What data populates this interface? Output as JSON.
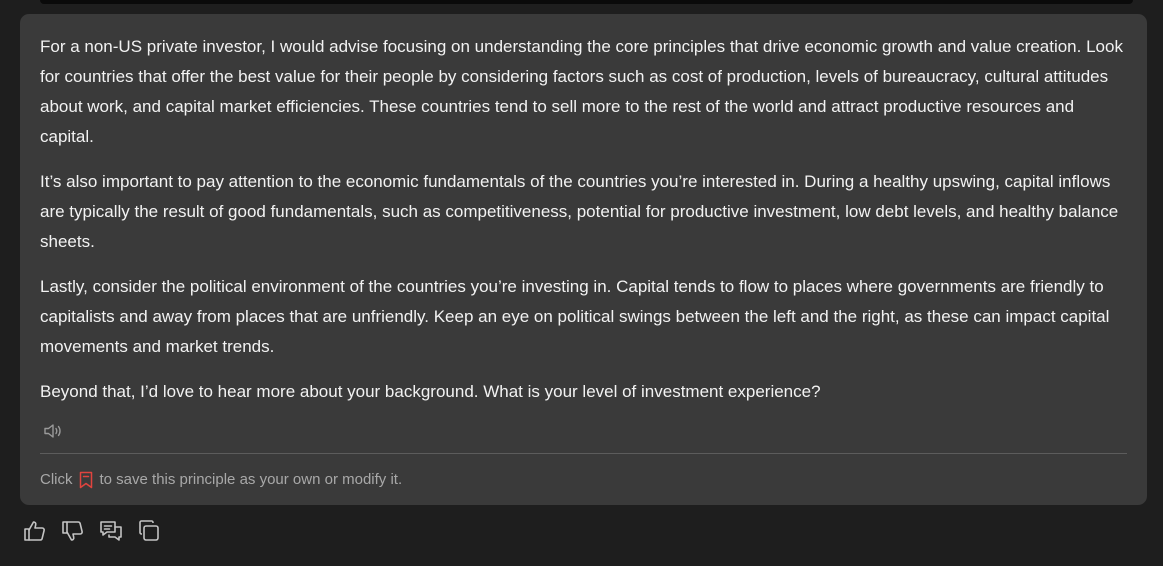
{
  "message": {
    "paragraphs": [
      "For a non-US private investor, I would advise focusing on understanding the core principles that drive economic growth and value creation. Look for countries that offer the best value for their people by considering factors such as cost of production, levels of bureaucracy, cultural attitudes about work, and capital market efficiencies. These countries tend to sell more to the rest of the world and attract productive resources and capital.",
      "It’s also important to pay attention to the economic fundamentals of the countries you’re interested in. During a healthy upswing, capital inflows are typically the result of good fundamentals, such as competitiveness, potential for productive investment, low debt levels, and healthy balance sheets.",
      "Lastly, consider the political environment of the countries you’re investing in. Capital tends to flow to places where governments are friendly to capitalists and away from places that are unfriendly. Keep an eye on political swings between the left and the right, as these can impact capital movements and market trends.",
      "Beyond that, I’d love to hear more about your background. What is your level of investment experience?"
    ]
  },
  "save_hint": {
    "prefix": "Click",
    "suffix": "to save this principle as your own or modify it."
  },
  "icons": {
    "speaker": "speaker-icon",
    "bookmark": "bookmark-icon",
    "thumbs_up": "thumbs-up-icon",
    "thumbs_down": "thumbs-down-icon",
    "feedback": "comment-icon",
    "copy": "copy-icon"
  },
  "colors": {
    "background": "#1e1e1e",
    "card": "#3a3a3a",
    "text": "#f2f2f2",
    "muted": "#a8a8a8",
    "accent": "#e0443e"
  }
}
